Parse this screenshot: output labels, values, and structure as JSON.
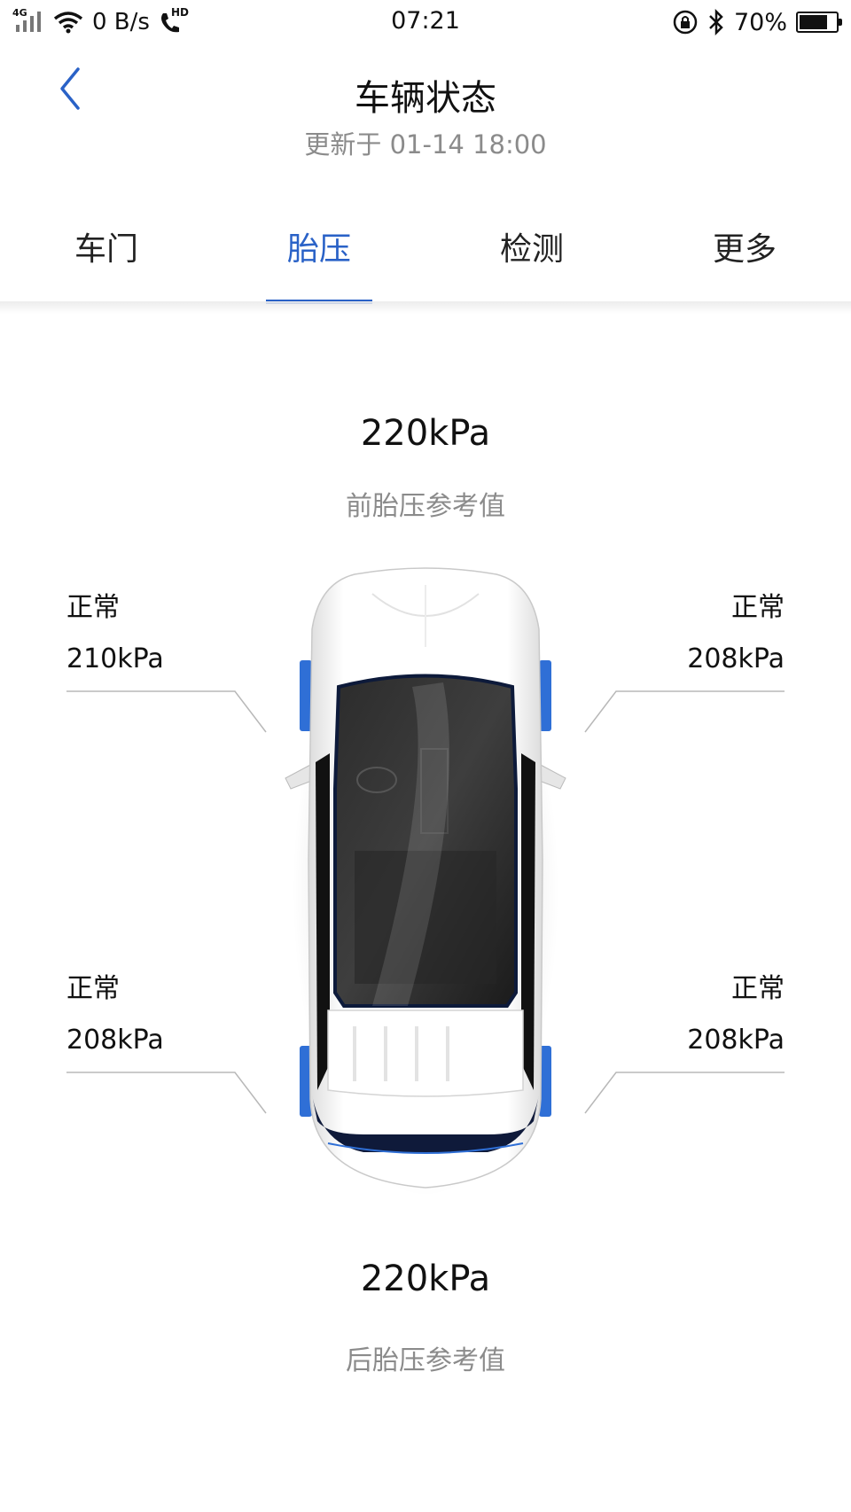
{
  "status_bar": {
    "network": "4G",
    "speed": "0 B/s",
    "call_badge": "HD",
    "time": "07:21",
    "battery": "70%",
    "battery_level": 0.7
  },
  "header": {
    "title": "车辆状态",
    "subtitle": "更新于 01-14 18:00"
  },
  "tabs": [
    {
      "label": "车门",
      "active": false
    },
    {
      "label": "胎压",
      "active": true
    },
    {
      "label": "检测",
      "active": false
    },
    {
      "label": "更多",
      "active": false
    }
  ],
  "front_reference": {
    "value": "220kPa",
    "label": "前胎压参考值"
  },
  "rear_reference": {
    "value": "220kPa",
    "label": "后胎压参考值"
  },
  "tires": {
    "front_left": {
      "status": "正常",
      "pressure": "210kPa"
    },
    "front_right": {
      "status": "正常",
      "pressure": "208kPa"
    },
    "rear_left": {
      "status": "正常",
      "pressure": "208kPa"
    },
    "rear_right": {
      "status": "正常",
      "pressure": "208kPa"
    }
  },
  "colors": {
    "accent": "#2a62c7",
    "secondary_text": "#8b8b8b"
  }
}
